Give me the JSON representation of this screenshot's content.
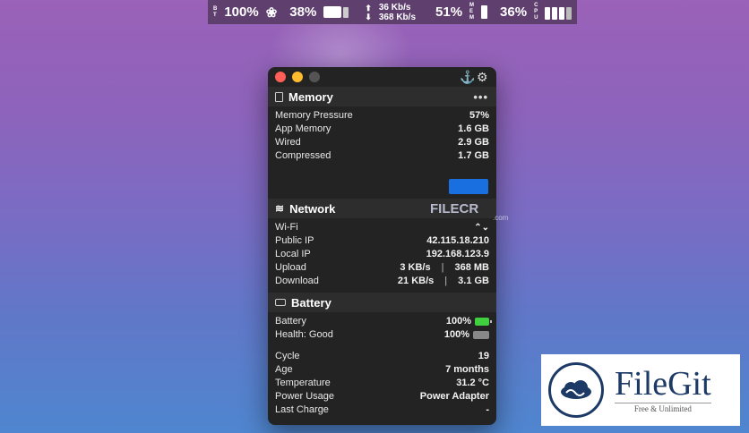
{
  "menubar": {
    "bt_label": "B\nT",
    "bt_percent": "100%",
    "cpu_percent": "38%",
    "net_up": "36 Kb/s",
    "net_down": "368 Kb/s",
    "mem_percent": "51%",
    "mem_label": "M\nE\nM",
    "cpu2_percent": "36%",
    "cpu2_label": "C\nP\nU"
  },
  "memory": {
    "title": "Memory",
    "more": "•••",
    "rows": [
      {
        "label": "Memory Pressure",
        "value": "57%"
      },
      {
        "label": "App Memory",
        "value": "1.6 GB"
      },
      {
        "label": "Wired",
        "value": "2.9 GB"
      },
      {
        "label": "Compressed",
        "value": "1.7 GB"
      }
    ]
  },
  "network": {
    "title": "Network",
    "wifi_label": "Wi-Fi",
    "public_ip_label": "Public IP",
    "public_ip": "42.115.18.210",
    "local_ip_label": "Local IP",
    "local_ip": "192.168.123.9",
    "upload_label": "Upload",
    "upload_rate": "3 KB/s",
    "upload_total": "368 MB",
    "download_label": "Download",
    "download_rate": "21 KB/s",
    "download_total": "3.1 GB",
    "separator": "|"
  },
  "battery": {
    "title": "Battery",
    "rows": [
      {
        "label": "Battery",
        "value": "100%"
      },
      {
        "label": "Health: Good",
        "value": "100%"
      }
    ],
    "details": [
      {
        "label": "Cycle",
        "value": "19"
      },
      {
        "label": "Age",
        "value": "7 months"
      },
      {
        "label": "Temperature",
        "value": "31.2 °C"
      },
      {
        "label": "Power Usage",
        "value": "Power Adapter"
      },
      {
        "label": "Last Charge",
        "value": "-"
      }
    ]
  },
  "watermark": {
    "filecr": "FILECR",
    "filecr_com": ".com",
    "filegit_name": "FileGit",
    "filegit_tag": "Free & Unlimited"
  },
  "colors": {
    "accent_blue": "#1a6fe0",
    "battery_green": "#3fcf3f",
    "close": "#ff5f57",
    "minimize": "#febc2e"
  }
}
